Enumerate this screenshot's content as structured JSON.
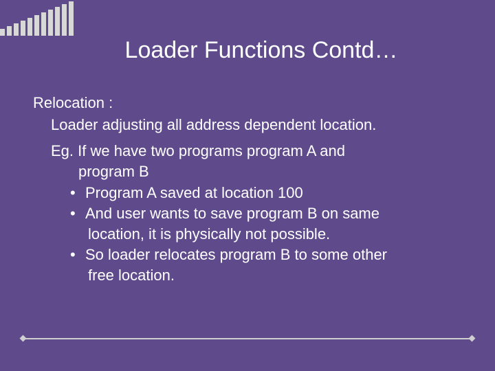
{
  "title": "Loader Functions Contd…",
  "relocation": {
    "heading": "Relocation :",
    "def": "Loader adjusting all address dependent location.",
    "eg_line1": "Eg. If we have two programs program A and",
    "eg_line2": "program B",
    "bullets": {
      "b1": "Program A saved at location 100",
      "b2_l1": "And user wants to save program B on same",
      "b2_l2": "location, it is physically not possible.",
      "b3_l1": "So loader relocates program B to some other",
      "b3_l2": "free location."
    }
  },
  "bullet_char": "•"
}
